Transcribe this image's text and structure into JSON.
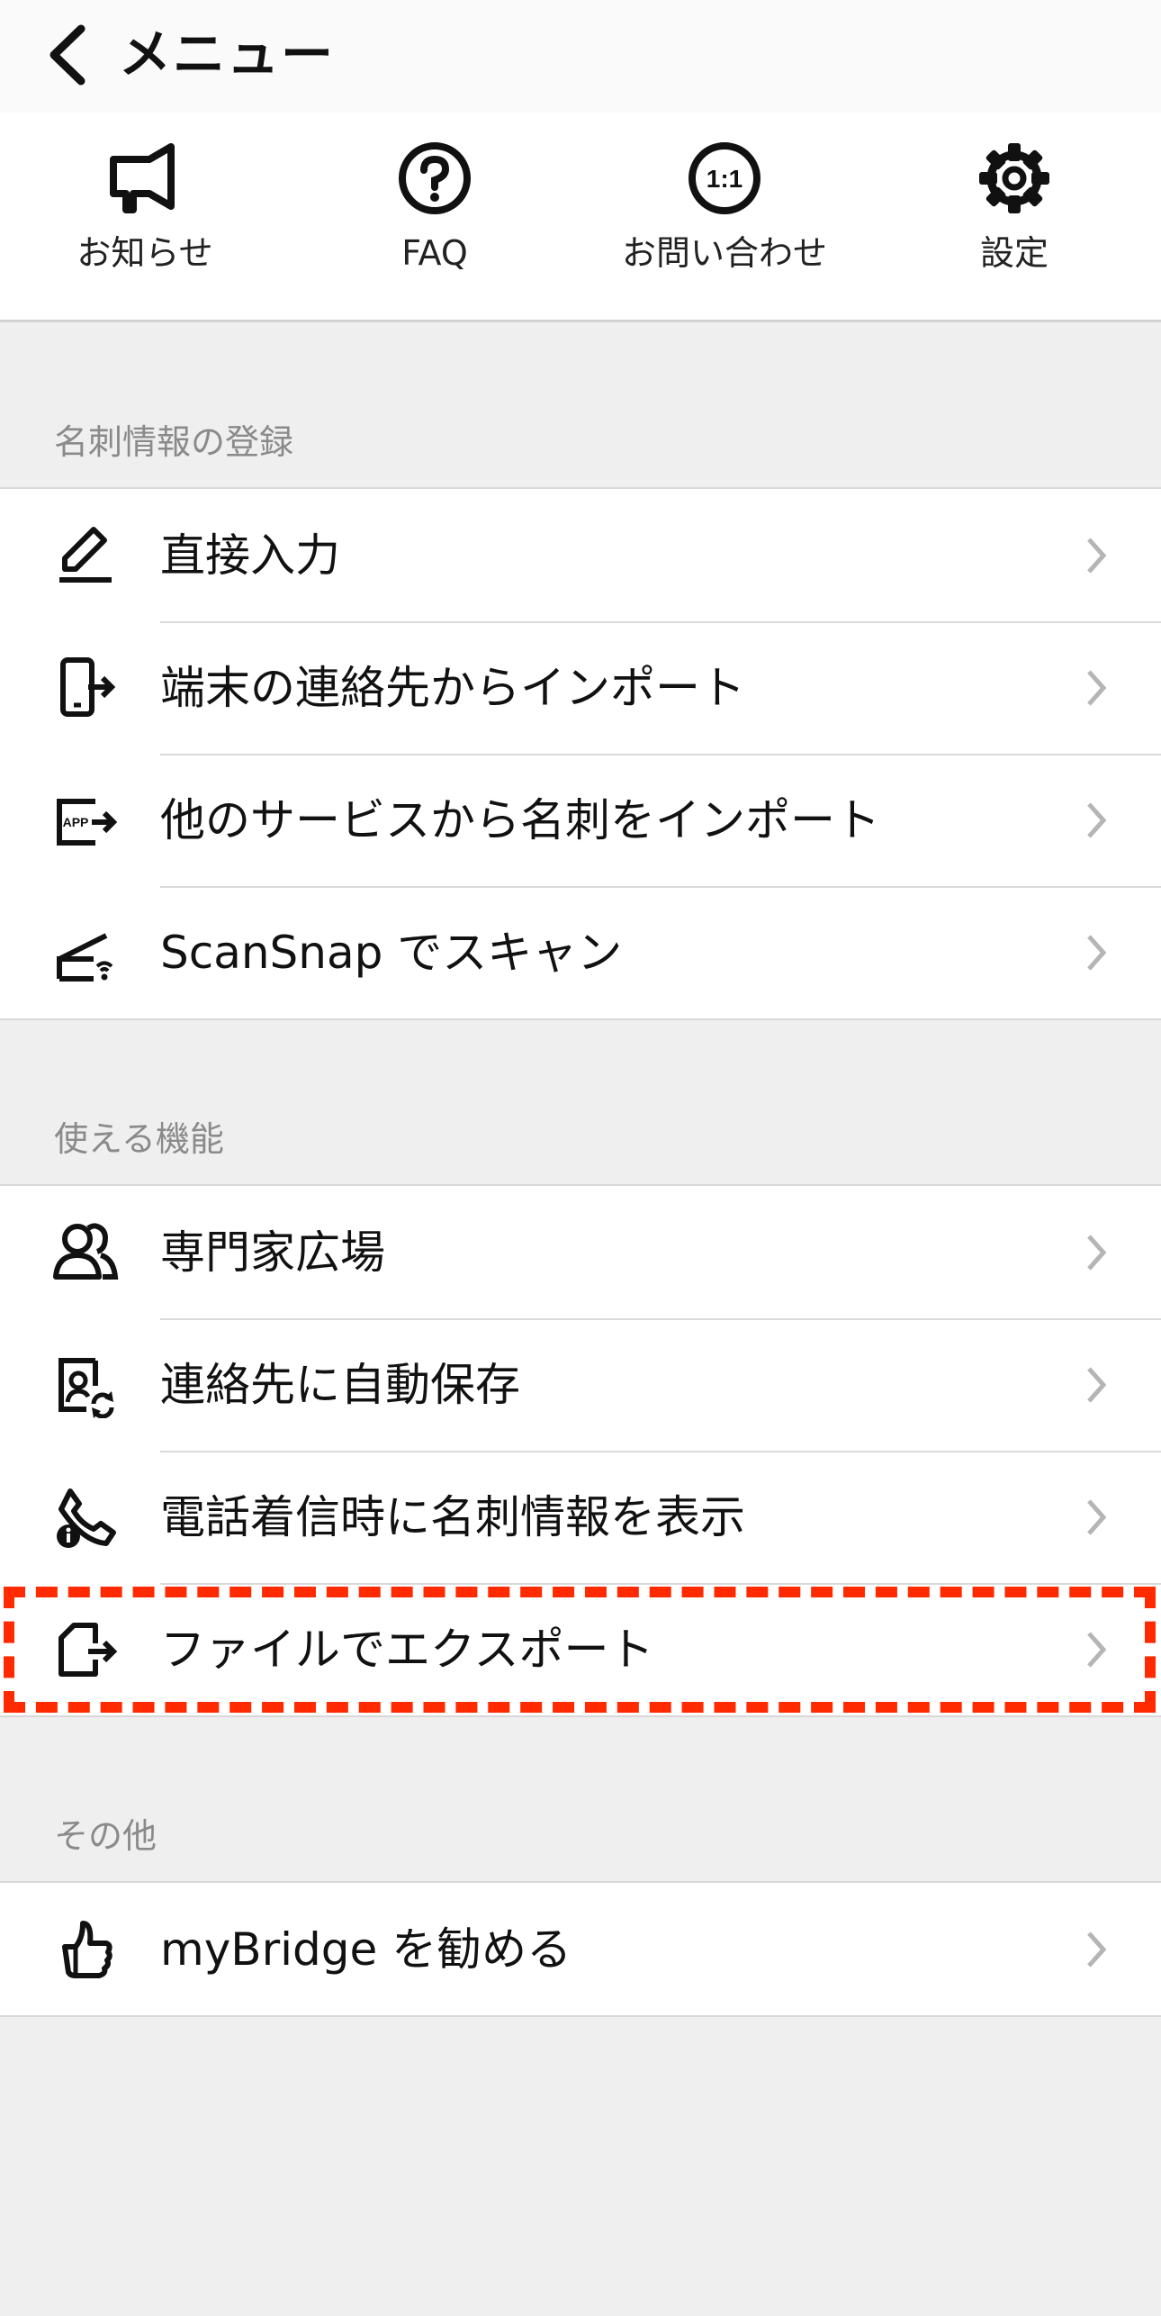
{
  "header": {
    "title": "メニュー"
  },
  "quick_actions": [
    {
      "label": "お知らせ",
      "icon": "megaphone-icon"
    },
    {
      "label": "FAQ",
      "icon": "question-circle-icon"
    },
    {
      "label": "お問い合わせ",
      "icon": "one-to-one-icon",
      "icon_text": "1:1"
    },
    {
      "label": "設定",
      "icon": "gear-icon"
    }
  ],
  "sections": [
    {
      "heading": "名刺情報の登録",
      "items": [
        {
          "label": "直接入力",
          "icon": "pencil-icon"
        },
        {
          "label": "端末の連絡先からインポート",
          "icon": "phone-import-icon"
        },
        {
          "label": "他のサービスから名刺をインポート",
          "icon": "app-import-icon",
          "icon_text": "APP"
        },
        {
          "label": "ScanSnap でスキャン",
          "icon": "scanner-icon"
        }
      ]
    },
    {
      "heading": "使える機能",
      "items": [
        {
          "label": "専門家広場",
          "icon": "people-icon"
        },
        {
          "label": "連絡先に自動保存",
          "icon": "contact-sync-icon"
        },
        {
          "label": "電話着信時に名刺情報を表示",
          "icon": "phone-info-icon"
        },
        {
          "label": "ファイルでエクスポート",
          "icon": "file-export-icon",
          "highlighted": true
        }
      ]
    },
    {
      "heading": "その他",
      "items": [
        {
          "label": "myBridge を勧める",
          "icon": "thumbs-up-icon"
        }
      ]
    }
  ],
  "colors": {
    "highlight": "#ff2a00",
    "background": "#efefef",
    "section_heading": "#8a8a8a",
    "chevron": "#b5b5b5"
  }
}
